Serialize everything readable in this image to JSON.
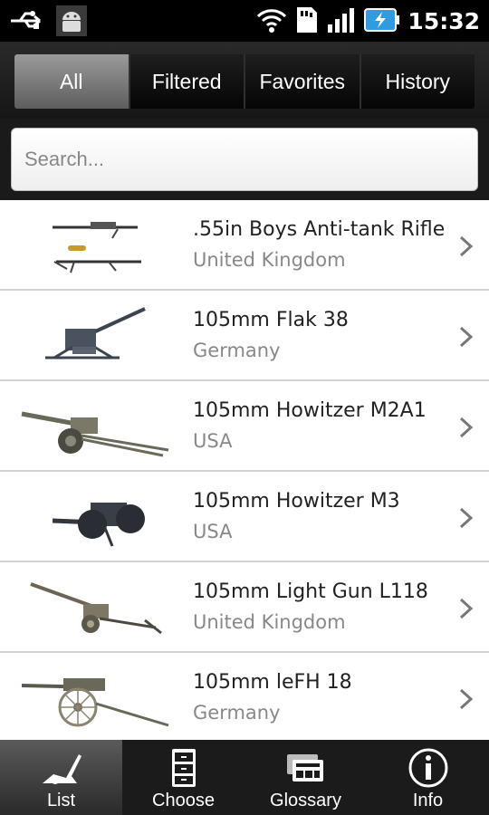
{
  "status_bar": {
    "time": "15:32",
    "icons": [
      "usb-icon",
      "android-debug-icon",
      "wifi-icon",
      "sd-card-icon",
      "signal-icon",
      "battery-charging-icon"
    ]
  },
  "tabs": [
    {
      "label": "All",
      "active": true
    },
    {
      "label": "Filtered",
      "active": false
    },
    {
      "label": "Favorites",
      "active": false
    },
    {
      "label": "History",
      "active": false
    }
  ],
  "search": {
    "placeholder": "Search...",
    "value": ""
  },
  "list": [
    {
      "name": ".55in Boys Anti-tank Rifle",
      "country": "United Kingdom",
      "icon": "rifle-thumbnail"
    },
    {
      "name": "105mm Flak 38",
      "country": "Germany",
      "icon": "flak-gun-thumbnail"
    },
    {
      "name": "105mm Howitzer M2A1",
      "country": "USA",
      "icon": "howitzer-thumbnail"
    },
    {
      "name": "105mm Howitzer M3",
      "country": "USA",
      "icon": "howitzer-thumbnail"
    },
    {
      "name": "105mm Light Gun L118",
      "country": "United Kingdom",
      "icon": "light-gun-thumbnail"
    },
    {
      "name": "105mm leFH 18",
      "country": "Germany",
      "icon": "field-howitzer-thumbnail"
    }
  ],
  "bottom_nav": [
    {
      "label": "List",
      "icon": "gun-list-icon",
      "active": true
    },
    {
      "label": "Choose",
      "icon": "cabinet-icon",
      "active": false
    },
    {
      "label": "Glossary",
      "icon": "glossary-cards-icon",
      "active": false
    },
    {
      "label": "Info",
      "icon": "info-icon",
      "active": false
    }
  ],
  "colors": {
    "accent_tab": "#7a7a7a",
    "status_bar": "#000000",
    "country_text": "#888888",
    "battery": "#2f9be0"
  }
}
